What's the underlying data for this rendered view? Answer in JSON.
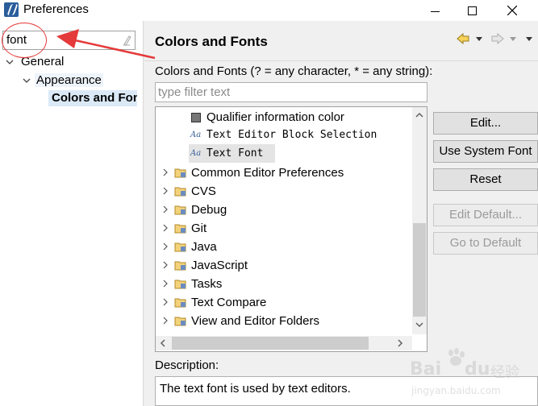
{
  "window": {
    "title": "Preferences"
  },
  "sidebar": {
    "filter_value": "font",
    "tree": [
      {
        "label": "General"
      },
      {
        "label": "Appearance"
      },
      {
        "label": "Colors and Fonts"
      }
    ]
  },
  "page": {
    "title": "Colors and Fonts",
    "description": "Colors and Fonts (? = any character, * = any string):",
    "filter_placeholder": "type filter text",
    "items": [
      {
        "label": "Qualifier information color",
        "kind": "color"
      },
      {
        "label": "Text Editor Block Selection",
        "kind": "font",
        "icon_text": "Aa"
      },
      {
        "label": "Text Font",
        "kind": "font",
        "icon_text": "Aa",
        "selected": true
      },
      {
        "label": "Common Editor Preferences",
        "kind": "folder"
      },
      {
        "label": "CVS",
        "kind": "folder"
      },
      {
        "label": "Debug",
        "kind": "folder"
      },
      {
        "label": "Git",
        "kind": "folder"
      },
      {
        "label": "Java",
        "kind": "folder"
      },
      {
        "label": "JavaScript",
        "kind": "folder"
      },
      {
        "label": "Tasks",
        "kind": "folder"
      },
      {
        "label": "Text Compare",
        "kind": "folder"
      },
      {
        "label": "View and Editor Folders",
        "kind": "folder"
      }
    ],
    "buttons": {
      "edit": "Edit...",
      "use_system_font": "Use System Font",
      "reset": "Reset",
      "edit_default": "Edit Default...",
      "go_to_default": "Go to Default"
    },
    "description_label": "Description:",
    "description_text": "The text font is used by text editors."
  },
  "watermark": {
    "logo": "Bai",
    "logo2": "du",
    "cn": "经验",
    "url": "jingyan.baidu.com"
  },
  "colors": {
    "annotation": "#e53a3a",
    "selection": "#dbe9f7",
    "accent": "#2a5d9a"
  }
}
